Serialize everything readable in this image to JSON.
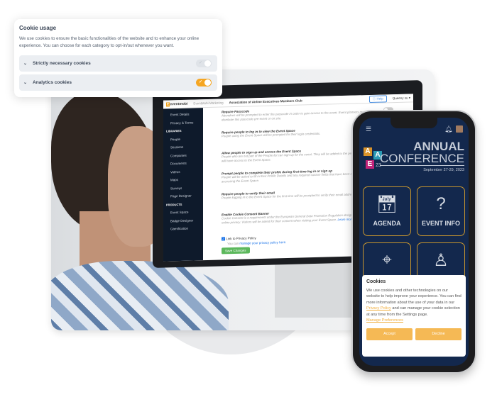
{
  "cookie_usage": {
    "title": "Cookie usage",
    "description": "We use cookies to ensure the basic functionalities of the website and to enhance your online experience. You can choose for each category to opt-in/out whenever you want.",
    "categories": [
      {
        "label": "Strictly necessary cookies",
        "enabled": true,
        "locked": true
      },
      {
        "label": "Analytics cookies",
        "enabled": true,
        "locked": false
      }
    ],
    "accent": "#f5a623"
  },
  "desktop": {
    "logo": "eventmobi",
    "workspace": "EventMobi Marketing",
    "event_name": "Association of Airline Executives Members Club",
    "help_label": "Help",
    "user": "Queeny su",
    "sidebar": {
      "items": [
        "Event Details",
        "Privacy & Terms"
      ],
      "libraries_header": "LIBRARIES",
      "libraries": [
        "People",
        "Sessions",
        "Companies",
        "Documents",
        "Videos",
        "Maps",
        "Surveys",
        "Page Designer"
      ],
      "products_header": "PRODUCTS",
      "products": [
        "Event Space",
        "Badge Designer",
        "Gamification"
      ]
    },
    "settings": [
      {
        "title": "Require Passcode",
        "desc": "Attendees will be prompted to enter the passcode in order to gain access to the event. Event planners must distribute this passcode pre-event or on site.",
        "on": false
      },
      {
        "title": "Require people to log in to view the Event Space",
        "desc": "People using the Event Space will be prompted for their login credentials.",
        "on": false
      },
      {
        "title": "Allow people to sign up and access the Event Space",
        "desc": "People who are not part of the People list can sign up for the event. They will be added to the people list and will have access to the Event Space.",
        "on": true
      },
      {
        "title": "Prompt people to complete their profile during first-time log in or sign up",
        "desc": "People will be asked to fill in their Profile Details and any required custom fields that have been added before accessing the Event Space.",
        "on": false
      },
      {
        "title": "Require people to verify their email",
        "desc": "People logging in to the Event Space for the first time will be prompted to verify their email address.",
        "on": true
      },
      {
        "title": "Enable Cookie Consent Banner",
        "desc": "Cookie Consent is a requirement under the European General Data Protection Regulation designed to protect online privacy. Visitors will be asked for their consent when visiting your Event Space.",
        "on": true
      }
    ],
    "learn_more": "Learn more",
    "privacy_checkbox": "Link to Privacy Policy",
    "privacy_checked": true,
    "privacy_text": "You can",
    "privacy_link": "manage your privacy policy here.",
    "save_label": "Save Changes"
  },
  "phone": {
    "logo_letters": [
      "A",
      "A",
      "E",
      "23"
    ],
    "title_line1": "ANNUAL",
    "title_line2": "CONFERENCE",
    "dates": "September 27-29, 2023",
    "tiles": [
      {
        "label": "AGENDA",
        "icon": "calendar-plane-icon"
      },
      {
        "label": "EVENT INFO",
        "icon": "question-pin-icon"
      },
      {
        "label": "",
        "icon": "map-pin-icon"
      },
      {
        "label": "",
        "icon": "speaker-podium-icon"
      }
    ],
    "cookies": {
      "title": "Cookies",
      "text1": "We use cookies and other technologies on our website to help improve your experience. You can find more information about the use of your data in our",
      "privacy_link": "Privacy Policy",
      "text2": "and can manage your cookie selection at any time from the Settings page.",
      "manage_link": "Manage Preferences",
      "accept": "Accept",
      "decline": "Decline"
    }
  }
}
